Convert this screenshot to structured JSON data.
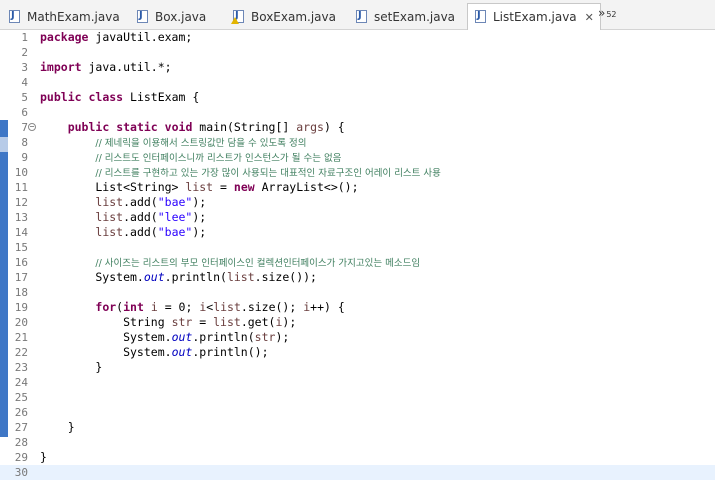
{
  "tabs": [
    {
      "label": "MathExam.java",
      "warning": false,
      "active": false,
      "icon": "java-file-icon"
    },
    {
      "label": "Box.java",
      "warning": false,
      "active": false,
      "icon": "java-file-icon"
    },
    {
      "label": "BoxExam.java",
      "warning": true,
      "active": false,
      "icon": "java-file-warning-icon"
    },
    {
      "label": "setExam.java",
      "warning": false,
      "active": false,
      "icon": "java-file-icon"
    },
    {
      "label": "ListExam.java",
      "warning": false,
      "active": true,
      "icon": "java-file-icon"
    }
  ],
  "active_tab_close": "✕",
  "overflow": {
    "icon": "»",
    "count": "52"
  },
  "colors": {
    "keyword": "#7f0055",
    "string": "#2a00ff",
    "comment": "#3f7f5f",
    "static_field": "#0000c0",
    "local_var": "#6a3e3e",
    "change_marker": "#3f77c6",
    "current_line": "#e8f2fe"
  },
  "lines": [
    {
      "n": "1",
      "tokens": [
        [
          "kw",
          "package"
        ],
        [
          "p",
          " javaUtil.exam;"
        ]
      ]
    },
    {
      "n": "2",
      "tokens": []
    },
    {
      "n": "3",
      "tokens": [
        [
          "kw",
          "import"
        ],
        [
          "p",
          " java.util.*;"
        ]
      ]
    },
    {
      "n": "4",
      "tokens": []
    },
    {
      "n": "5",
      "tokens": [
        [
          "kw",
          "public"
        ],
        [
          "p",
          " "
        ],
        [
          "kw",
          "class"
        ],
        [
          "p",
          " ListExam {"
        ]
      ]
    },
    {
      "n": "6",
      "tokens": []
    },
    {
      "n": "7",
      "fold": true,
      "tokens": [
        [
          "p",
          "    "
        ],
        [
          "kw",
          "public"
        ],
        [
          "p",
          " "
        ],
        [
          "kw",
          "static"
        ],
        [
          "p",
          " "
        ],
        [
          "kw",
          "void"
        ],
        [
          "p",
          " main(String[] "
        ],
        [
          "var",
          "args"
        ],
        [
          "p",
          ") {"
        ]
      ]
    },
    {
      "n": "8",
      "tokens": [
        [
          "p",
          "        "
        ],
        [
          "cm",
          "// 제네릭을 이용해서 스트링값만 담을 수 있도록 정의"
        ]
      ]
    },
    {
      "n": "9",
      "tokens": [
        [
          "p",
          "        "
        ],
        [
          "cm",
          "// 리스트도 인터페이스니까 리스트가 인스턴스가 될 수는 없음"
        ]
      ]
    },
    {
      "n": "10",
      "tokens": [
        [
          "p",
          "        "
        ],
        [
          "cm",
          "// 리스트를 구현하고 있는 가장 많이 사용되는 대표적인 자료구조인 어레이 리스트 사용"
        ]
      ]
    },
    {
      "n": "11",
      "tokens": [
        [
          "p",
          "        List<String> "
        ],
        [
          "var",
          "list"
        ],
        [
          "p",
          " = "
        ],
        [
          "kw",
          "new"
        ],
        [
          "p",
          " ArrayList<>();"
        ]
      ]
    },
    {
      "n": "12",
      "tokens": [
        [
          "p",
          "        "
        ],
        [
          "var",
          "list"
        ],
        [
          "p",
          ".add("
        ],
        [
          "str",
          "\"bae\""
        ],
        [
          "p",
          ");"
        ]
      ]
    },
    {
      "n": "13",
      "tokens": [
        [
          "p",
          "        "
        ],
        [
          "var",
          "list"
        ],
        [
          "p",
          ".add("
        ],
        [
          "str",
          "\"lee\""
        ],
        [
          "p",
          ");"
        ]
      ]
    },
    {
      "n": "14",
      "tokens": [
        [
          "p",
          "        "
        ],
        [
          "var",
          "list"
        ],
        [
          "p",
          ".add("
        ],
        [
          "str",
          "\"bae\""
        ],
        [
          "p",
          ");"
        ]
      ]
    },
    {
      "n": "15",
      "tokens": []
    },
    {
      "n": "16",
      "tokens": [
        [
          "p",
          "        "
        ],
        [
          "cm",
          "// 사이즈는 리스트의 부모 인터페이스인 컬렉션인터페이스가 가지고있는 메소드임"
        ]
      ]
    },
    {
      "n": "17",
      "tokens": [
        [
          "p",
          "        System."
        ],
        [
          "fld",
          "out"
        ],
        [
          "p",
          ".println("
        ],
        [
          "var",
          "list"
        ],
        [
          "p",
          ".size());"
        ]
      ]
    },
    {
      "n": "18",
      "tokens": []
    },
    {
      "n": "19",
      "tokens": [
        [
          "p",
          "        "
        ],
        [
          "kw",
          "for"
        ],
        [
          "p",
          "("
        ],
        [
          "kw",
          "int"
        ],
        [
          "p",
          " "
        ],
        [
          "var",
          "i"
        ],
        [
          "p",
          " = 0; "
        ],
        [
          "var",
          "i"
        ],
        [
          "p",
          "<"
        ],
        [
          "var",
          "list"
        ],
        [
          "p",
          ".size(); "
        ],
        [
          "var",
          "i"
        ],
        [
          "p",
          "++) {"
        ]
      ]
    },
    {
      "n": "20",
      "tokens": [
        [
          "p",
          "            String "
        ],
        [
          "var",
          "str"
        ],
        [
          "p",
          " = "
        ],
        [
          "var",
          "list"
        ],
        [
          "p",
          ".get("
        ],
        [
          "var",
          "i"
        ],
        [
          "p",
          ");"
        ]
      ]
    },
    {
      "n": "21",
      "tokens": [
        [
          "p",
          "            System."
        ],
        [
          "fld",
          "out"
        ],
        [
          "p",
          ".println("
        ],
        [
          "var",
          "str"
        ],
        [
          "p",
          ");"
        ]
      ]
    },
    {
      "n": "22",
      "tokens": [
        [
          "p",
          "            System."
        ],
        [
          "fld",
          "out"
        ],
        [
          "p",
          ".println();"
        ]
      ]
    },
    {
      "n": "23",
      "tokens": [
        [
          "p",
          "        }"
        ]
      ]
    },
    {
      "n": "24",
      "tokens": []
    },
    {
      "n": "25",
      "tokens": []
    },
    {
      "n": "26",
      "tokens": []
    },
    {
      "n": "27",
      "tokens": [
        [
          "p",
          "    }"
        ]
      ]
    },
    {
      "n": "28",
      "tokens": []
    },
    {
      "n": "29",
      "tokens": [
        [
          "p",
          "}"
        ]
      ]
    },
    {
      "n": "30",
      "tokens": [],
      "current": true
    }
  ]
}
